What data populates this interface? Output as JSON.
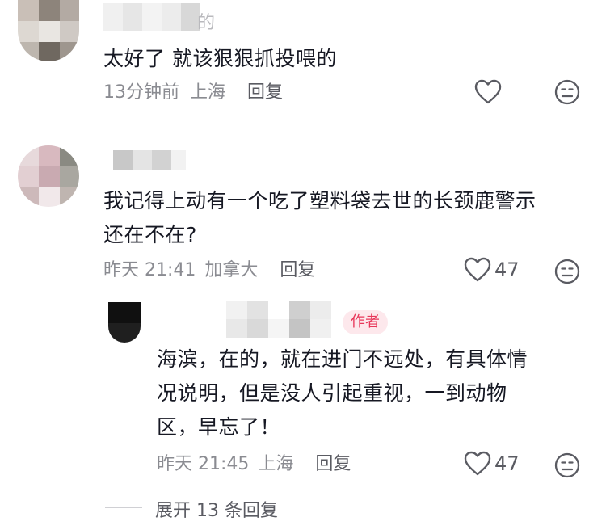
{
  "comments": [
    {
      "text": "太好了 就该狠狠抓投喂的",
      "time": "13分钟前",
      "location": "上海",
      "reply_label": "回复",
      "likes": "",
      "name_tail": "的"
    },
    {
      "text_line1": "我记得上动有一个吃了塑料袋去世的长颈鹿警示",
      "text_line2": "还在不在?",
      "time": "昨天 21:41",
      "location": "加拿大",
      "reply_label": "回复",
      "likes": "47"
    }
  ],
  "reply": {
    "author_badge": "作者",
    "text_line1": "海滨，在的，就在进门不远处，有具体情",
    "text_line2": "况说明，但是没人引起重视，一到动物",
    "text_line3": "区，早忘了！",
    "time": "昨天 21:45",
    "location": "上海",
    "reply_label": "回复",
    "likes": "47"
  },
  "expand": {
    "label": "展开 13 条回复"
  },
  "icons": {
    "like": "heart-outline-icon",
    "dislike": "meh-face-icon"
  },
  "colors": {
    "text": "#161823",
    "meta": "#8a8b91",
    "badge_bg": "#fde8ec",
    "badge_text": "#e8375a"
  }
}
